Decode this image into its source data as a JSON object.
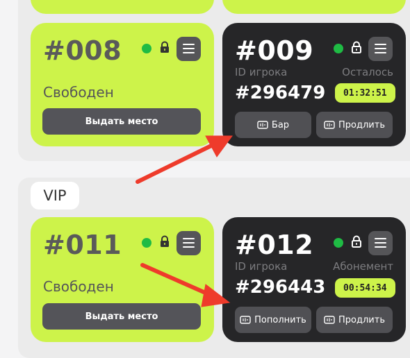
{
  "sections": {
    "vip_label": "VIP"
  },
  "cards": {
    "c008": {
      "number": "#008",
      "status": "Свободен",
      "action": "Выдать место"
    },
    "c009": {
      "number": "#009",
      "player_label": "ID игрока",
      "remaining_label": "Осталось",
      "player_id": "#296479",
      "timer": "01:32:51",
      "btn_left": "Бар",
      "btn_right": "Продлить"
    },
    "c011": {
      "number": "#011",
      "status": "Свободен",
      "action": "Выдать место"
    },
    "c012": {
      "number": "#012",
      "player_label": "ID игрока",
      "remaining_label": "Абонемент",
      "player_id": "#296443",
      "timer": "00:54:34",
      "btn_left": "Пополнить",
      "btn_right": "Продлить"
    }
  },
  "colors": {
    "free_card": "#cdf34a",
    "busy_card": "#262628",
    "online_dot": "#1fbb44",
    "arrow": "#ee3b2b"
  },
  "icons": [
    "lock-icon",
    "menu-icon",
    "ticket-icon",
    "arrow-annotation"
  ]
}
